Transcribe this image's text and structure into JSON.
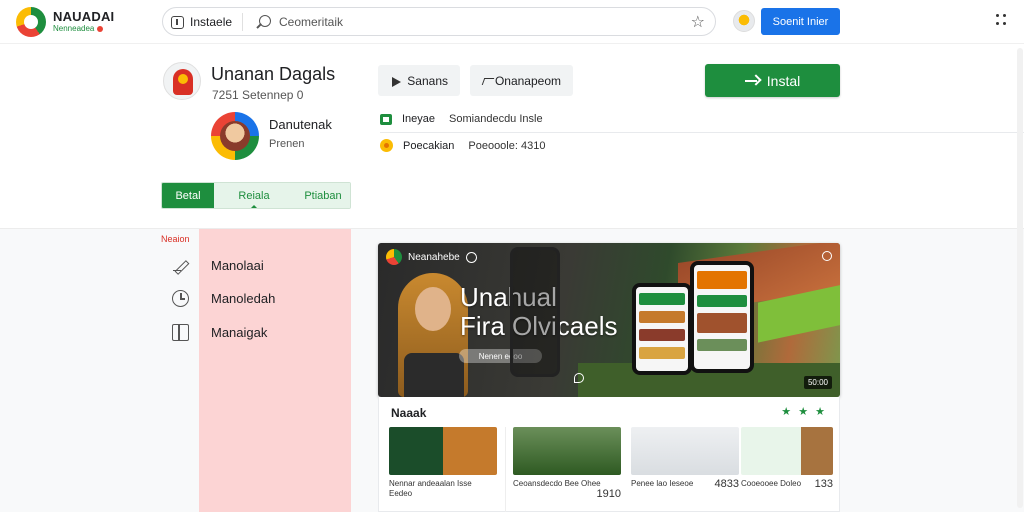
{
  "brand": {
    "name": "NAUADAI",
    "sub": "Nenneadea"
  },
  "topbar": {
    "nav_label": "Instaele",
    "search_query": "Ceomeritaik",
    "signin_label": "Soenit Inier"
  },
  "app": {
    "title": "Unanan Dagals",
    "meta": "7251  Setennep 0"
  },
  "developer": {
    "name": "Danutenak",
    "sub": "Prenen"
  },
  "actions": {
    "share_label": "Sanans",
    "compare_label": "Onanapeom",
    "install_label": "Instal"
  },
  "info": [
    {
      "key": "Ineyae",
      "value": "Somiandecdu Insle"
    },
    {
      "key": "Poecakian",
      "value": "Poeooole:   4310"
    }
  ],
  "tabs": [
    "Betal",
    "Reiala",
    "Ptiaban"
  ],
  "sidebar": {
    "label": "Neaion",
    "items": [
      {
        "label": "Manolaai",
        "icon": "pencil-icon"
      },
      {
        "label": "Manoledah",
        "icon": "clock-icon"
      },
      {
        "label": "Manaigak",
        "icon": "book-icon"
      }
    ]
  },
  "banner": {
    "channel": "Neanahebe",
    "title_line1": "Unahual",
    "title_line2": "Fira Olvicaels",
    "pill": "Nenen  eeoo",
    "counter": "50:00"
  },
  "related": {
    "title": "Naaak",
    "stars": "★ ★ ★",
    "cards": [
      {
        "text": "Nennar andeaalan  Isse  Eedeo",
        "num": ""
      },
      {
        "text": "Ceoansdecdo Bee Ohee",
        "num": "1910"
      },
      {
        "text": "Penee lao Ieseoe",
        "num": "4833"
      },
      {
        "text": "Cooeooee  Doleo",
        "num": "133"
      }
    ]
  }
}
